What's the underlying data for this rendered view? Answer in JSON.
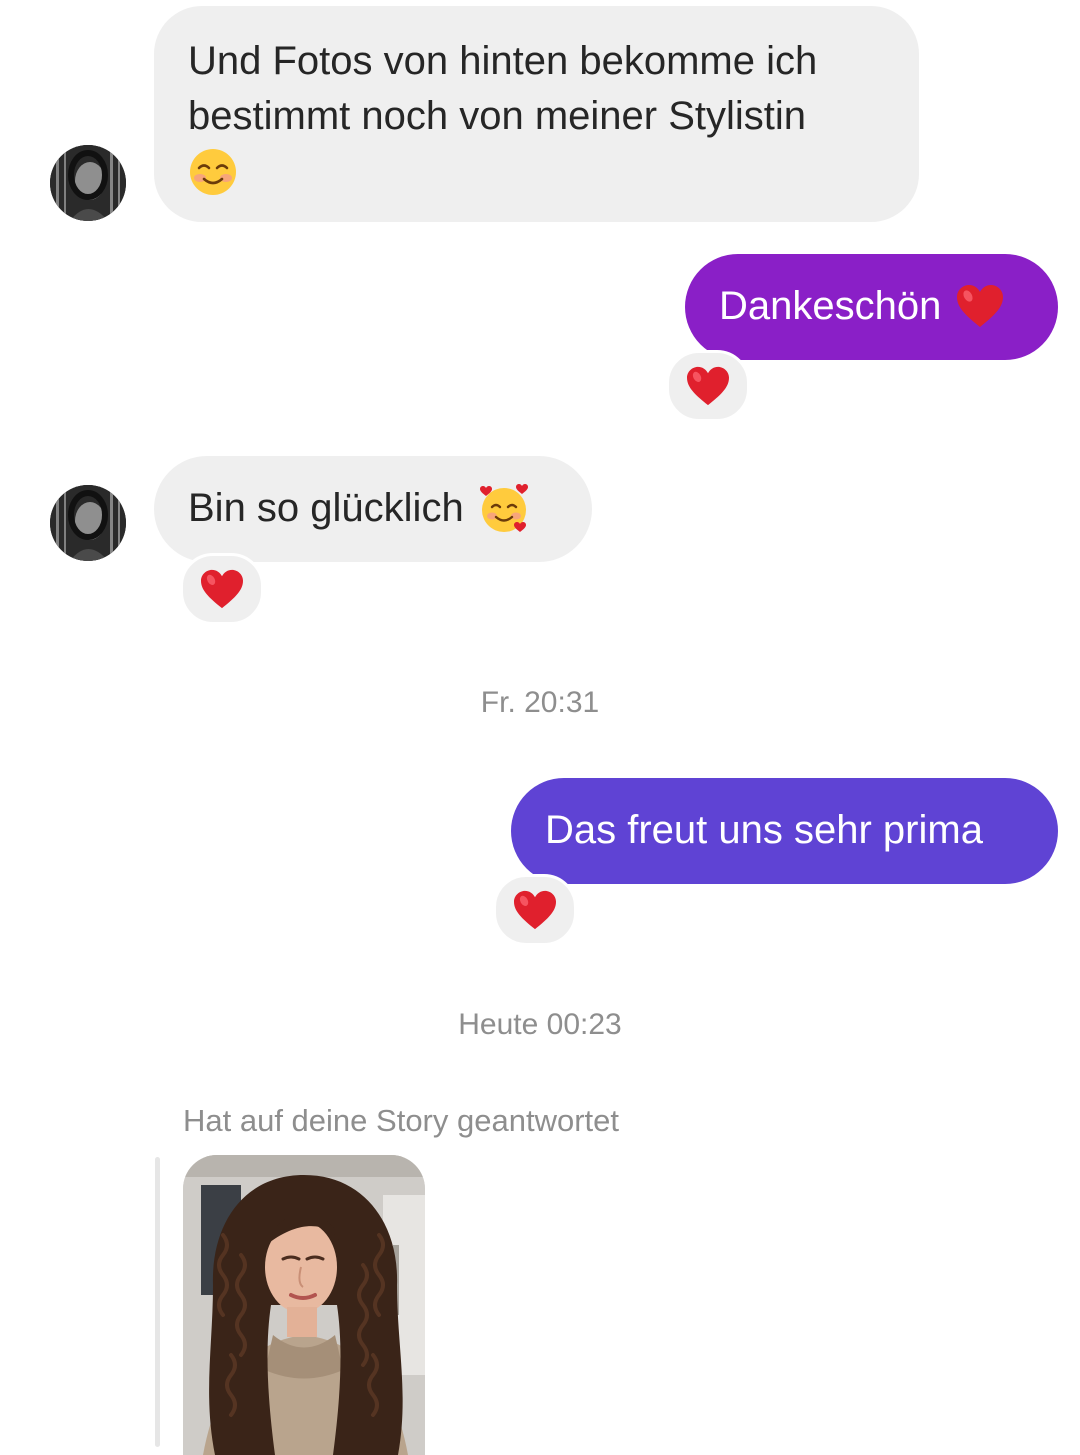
{
  "messages": [
    {
      "sender": "them",
      "lines": [
        "Und Fotos von hinten bekomme ich",
        "bestimmt noch von meiner Stylistin"
      ],
      "emoji": "smiling-face-icon"
    },
    {
      "sender": "me",
      "text": "Dankeschön",
      "emoji": "red-heart-icon",
      "reaction": "red-heart-icon"
    },
    {
      "sender": "them",
      "text": "Bin so glücklich",
      "emoji": "smiling-face-with-hearts-icon",
      "reaction": "red-heart-icon"
    },
    {
      "sender": "me",
      "text": "Das freut uns sehr prima",
      "reaction": "red-heart-icon"
    }
  ],
  "timestamps": {
    "first": "Fr. 20:31",
    "second": "Heute 00:23"
  },
  "story_reply": {
    "caption": "Hat auf deine Story geantwortet"
  },
  "colors": {
    "incoming_bubble": "#efefef",
    "outgoing_bubble_1": "#8a1fc7",
    "outgoing_bubble_2": "#5f43d4",
    "timestamp_text": "#8e8e8e",
    "heart": "#e0202d"
  }
}
